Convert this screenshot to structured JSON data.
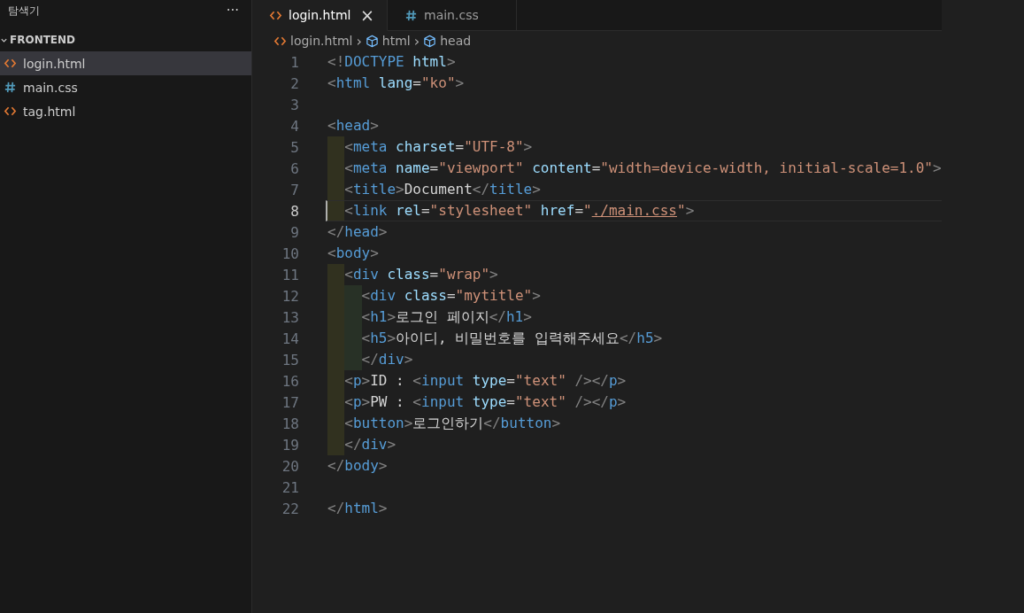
{
  "sidebar": {
    "title": "탐색기",
    "more": "···",
    "folder": {
      "name": "FRONTEND",
      "expanded": true
    },
    "files": [
      {
        "name": "login.html",
        "kind": "html",
        "selected": true
      },
      {
        "name": "main.css",
        "kind": "css",
        "selected": false
      },
      {
        "name": "tag.html",
        "kind": "html",
        "selected": false
      }
    ]
  },
  "tabs": [
    {
      "label": "login.html",
      "kind": "html",
      "selected": true,
      "close": "×"
    },
    {
      "label": "main.css",
      "kind": "css",
      "selected": false
    }
  ],
  "breadcrumb": [
    {
      "label": "login.html",
      "kind": "html"
    },
    {
      "label": "html",
      "kind": "element"
    },
    {
      "label": "head",
      "kind": "element"
    }
  ],
  "breadcrumb_separator": "›",
  "code": [
    {
      "n": "1",
      "active": false,
      "tokens": [
        {
          "kind": "p",
          "t": "<!"
        },
        {
          "kind": "tag",
          "t": "DOCTYPE"
        },
        {
          "kind": "attr",
          "t": " html"
        },
        {
          "kind": "p",
          "t": ">"
        }
      ]
    },
    {
      "n": "2",
      "active": false,
      "tokens": [
        {
          "kind": "p",
          "t": "<"
        },
        {
          "kind": "tag",
          "t": "html"
        },
        {
          "kind": "attr",
          "t": " lang"
        },
        {
          "kind": "text",
          "t": "="
        },
        {
          "kind": "str",
          "t": "\"ko\""
        },
        {
          "kind": "p",
          "t": ">"
        }
      ]
    },
    {
      "n": "3",
      "active": false
    },
    {
      "n": "4",
      "active": false,
      "tokens": [
        {
          "kind": "p",
          "t": "<"
        },
        {
          "kind": "tag",
          "t": "head"
        },
        {
          "kind": "p",
          "t": ">"
        }
      ],
      "children": [
        {
          "n": "5",
          "active": false,
          "tokens": [
            {
              "kind": "p",
              "t": "<"
            },
            {
              "kind": "tag",
              "t": "meta"
            },
            {
              "kind": "attr",
              "t": " charset"
            },
            {
              "kind": "text",
              "t": "="
            },
            {
              "kind": "str",
              "t": "\"UTF-8\""
            },
            {
              "kind": "p",
              "t": ">"
            }
          ]
        },
        {
          "n": "6",
          "active": false,
          "tokens": [
            {
              "kind": "p",
              "t": "<"
            },
            {
              "kind": "tag",
              "t": "meta"
            },
            {
              "kind": "attr",
              "t": " name"
            },
            {
              "kind": "text",
              "t": "="
            },
            {
              "kind": "str",
              "t": "\"viewport\""
            },
            {
              "kind": "attr",
              "t": " content"
            },
            {
              "kind": "text",
              "t": "="
            },
            {
              "kind": "str",
              "t": "\"width=device-width, initial-scale=1.0\""
            },
            {
              "kind": "p",
              "t": ">"
            }
          ]
        },
        {
          "n": "7",
          "active": false,
          "tokens": [
            {
              "kind": "p",
              "t": "<"
            },
            {
              "kind": "tag",
              "t": "title"
            },
            {
              "kind": "p",
              "t": ">"
            },
            {
              "kind": "text",
              "t": "Document"
            },
            {
              "kind": "p",
              "t": "</"
            },
            {
              "kind": "tag",
              "t": "title"
            },
            {
              "kind": "p",
              "t": ">"
            }
          ]
        },
        {
          "n": "8",
          "active": true,
          "tokens": [
            {
              "kind": "p",
              "t": "<"
            },
            {
              "kind": "tag",
              "t": "link"
            },
            {
              "kind": "attr",
              "t": " rel"
            },
            {
              "kind": "text",
              "t": "="
            },
            {
              "kind": "str",
              "t": "\"stylesheet\""
            },
            {
              "kind": "attr",
              "t": " href"
            },
            {
              "kind": "text",
              "t": "="
            },
            {
              "kind": "str",
              "t": "\""
            },
            {
              "kind": "link",
              "t": "./main.css"
            },
            {
              "kind": "str",
              "t": "\""
            },
            {
              "kind": "p",
              "t": ">"
            }
          ]
        }
      ]
    },
    {
      "n": "9",
      "active": false,
      "tokens": [
        {
          "kind": "p",
          "t": "</"
        },
        {
          "kind": "tag",
          "t": "head"
        },
        {
          "kind": "p",
          "t": ">"
        }
      ]
    },
    {
      "n": "10",
      "active": false,
      "tokens": [
        {
          "kind": "p",
          "t": "<"
        },
        {
          "kind": "tag",
          "t": "body"
        },
        {
          "kind": "p",
          "t": ">"
        }
      ],
      "children": [
        {
          "n": "11",
          "active": false,
          "tokens": [
            {
              "kind": "p",
              "t": "<"
            },
            {
              "kind": "tag",
              "t": "div"
            },
            {
              "kind": "attr",
              "t": " class"
            },
            {
              "kind": "text",
              "t": "="
            },
            {
              "kind": "str",
              "t": "\"wrap\""
            },
            {
              "kind": "p",
              "t": ">"
            }
          ],
          "children": [
            {
              "n": "12",
              "active": false,
              "tokens": [
                {
                  "kind": "p",
                  "t": "<"
                },
                {
                  "kind": "tag",
                  "t": "div"
                },
                {
                  "kind": "attr",
                  "t": " class"
                },
                {
                  "kind": "text",
                  "t": "="
                },
                {
                  "kind": "str",
                  "t": "\"mytitle\""
                },
                {
                  "kind": "p",
                  "t": ">"
                }
              ]
            },
            {
              "n": "13",
              "active": false,
              "tokens": [
                {
                  "kind": "p",
                  "t": "<"
                },
                {
                  "kind": "tag",
                  "t": "h1"
                },
                {
                  "kind": "p",
                  "t": ">"
                },
                {
                  "kind": "text",
                  "t": "로그인 페이지"
                },
                {
                  "kind": "p",
                  "t": "</"
                },
                {
                  "kind": "tag",
                  "t": "h1"
                },
                {
                  "kind": "p",
                  "t": ">"
                }
              ]
            },
            {
              "n": "14",
              "active": false,
              "tokens": [
                {
                  "kind": "p",
                  "t": "<"
                },
                {
                  "kind": "tag",
                  "t": "h5"
                },
                {
                  "kind": "p",
                  "t": ">"
                },
                {
                  "kind": "text",
                  "t": "아이디, 비밀번호를 입력해주세요"
                },
                {
                  "kind": "p",
                  "t": "</"
                },
                {
                  "kind": "tag",
                  "t": "h5"
                },
                {
                  "kind": "p",
                  "t": ">"
                }
              ]
            },
            {
              "n": "15",
              "active": false,
              "tokens": [
                {
                  "kind": "p",
                  "t": "</"
                },
                {
                  "kind": "tag",
                  "t": "div"
                },
                {
                  "kind": "p",
                  "t": ">"
                }
              ]
            }
          ]
        },
        {
          "n": "16",
          "active": false,
          "tokens": [
            {
              "kind": "p",
              "t": "<"
            },
            {
              "kind": "tag",
              "t": "p"
            },
            {
              "kind": "p",
              "t": ">"
            },
            {
              "kind": "text",
              "t": "ID : "
            },
            {
              "kind": "p",
              "t": "<"
            },
            {
              "kind": "tag",
              "t": "input"
            },
            {
              "kind": "attr",
              "t": " type"
            },
            {
              "kind": "text",
              "t": "="
            },
            {
              "kind": "str",
              "t": "\"text\""
            },
            {
              "kind": "p",
              "t": " /></"
            },
            {
              "kind": "tag",
              "t": "p"
            },
            {
              "kind": "p",
              "t": ">"
            }
          ]
        },
        {
          "n": "17",
          "active": false,
          "tokens": [
            {
              "kind": "p",
              "t": "<"
            },
            {
              "kind": "tag",
              "t": "p"
            },
            {
              "kind": "p",
              "t": ">"
            },
            {
              "kind": "text",
              "t": "PW : "
            },
            {
              "kind": "p",
              "t": "<"
            },
            {
              "kind": "tag",
              "t": "input"
            },
            {
              "kind": "attr",
              "t": " type"
            },
            {
              "kind": "text",
              "t": "="
            },
            {
              "kind": "str",
              "t": "\"text\""
            },
            {
              "kind": "p",
              "t": " /></"
            },
            {
              "kind": "tag",
              "t": "p"
            },
            {
              "kind": "p",
              "t": ">"
            }
          ]
        },
        {
          "n": "18",
          "active": false,
          "tokens": [
            {
              "kind": "p",
              "t": "<"
            },
            {
              "kind": "tag",
              "t": "button"
            },
            {
              "kind": "p",
              "t": ">"
            },
            {
              "kind": "text",
              "t": "로그인하기"
            },
            {
              "kind": "p",
              "t": "</"
            },
            {
              "kind": "tag",
              "t": "button"
            },
            {
              "kind": "p",
              "t": ">"
            }
          ]
        },
        {
          "n": "19",
          "active": false,
          "tokens": [
            {
              "kind": "p",
              "t": "</"
            },
            {
              "kind": "tag",
              "t": "div"
            },
            {
              "kind": "p",
              "t": ">"
            }
          ]
        }
      ]
    },
    {
      "n": "20",
      "active": false,
      "tokens": [
        {
          "kind": "p",
          "t": "</"
        },
        {
          "kind": "tag",
          "t": "body"
        },
        {
          "kind": "p",
          "t": ">"
        }
      ]
    },
    {
      "n": "21",
      "active": false
    },
    {
      "n": "22",
      "active": false,
      "tokens": [
        {
          "kind": "p",
          "t": "</"
        },
        {
          "kind": "tag",
          "t": "html"
        },
        {
          "kind": "p",
          "t": ">"
        }
      ]
    }
  ]
}
